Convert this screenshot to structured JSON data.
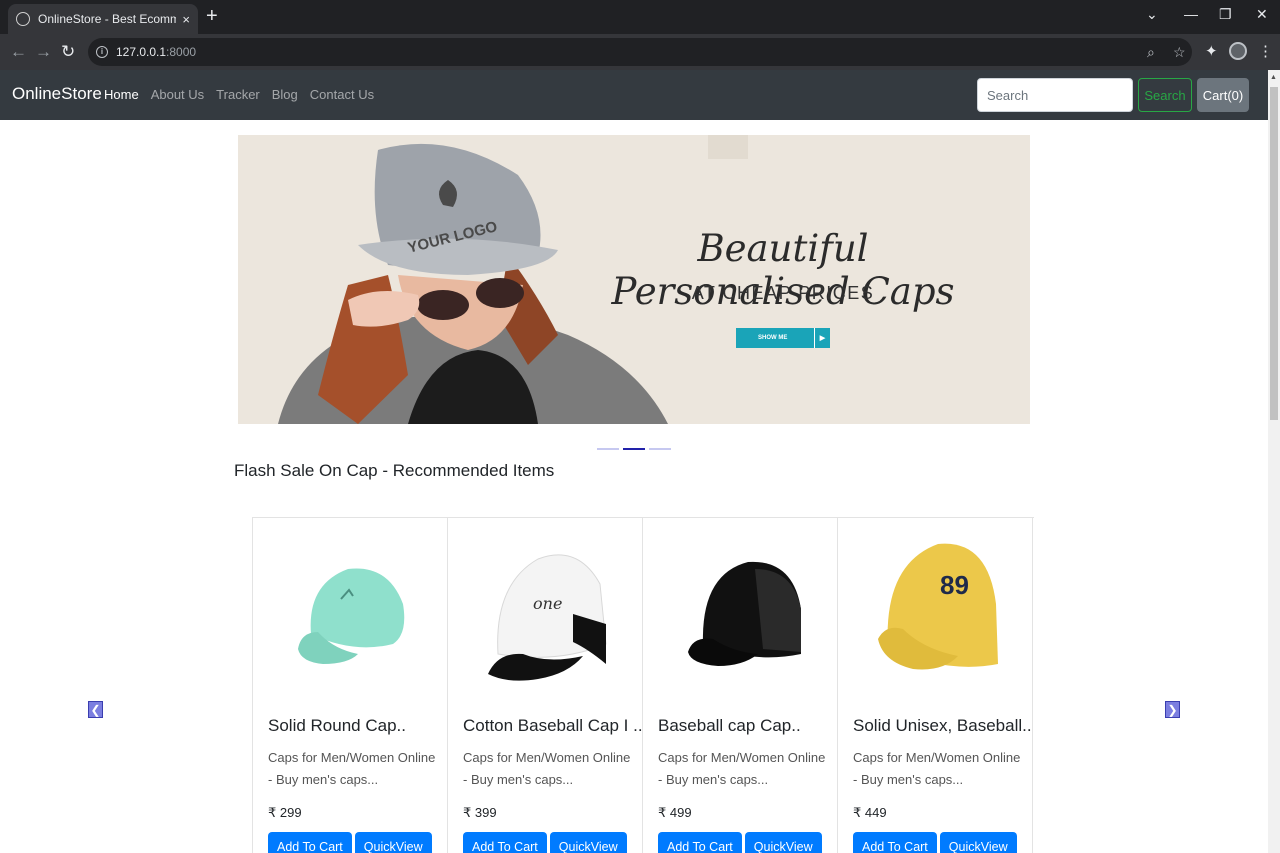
{
  "browser": {
    "tab_title": "OnlineStore - Best Ecommerce W",
    "tab_close": "×",
    "new_tab": "+",
    "url_host": "127.0.0.1",
    "url_port": ":8000"
  },
  "nav": {
    "brand": "OnlineStore",
    "links": [
      "Home",
      "About Us",
      "Tracker",
      "Blog",
      "Contact Us"
    ],
    "search_placeholder": "Search",
    "search_button": "Search",
    "cart_button": "Cart(0)"
  },
  "banner": {
    "headline": "Beautiful Personalised Caps",
    "subheadline": "AT CHEAP PRICES",
    "cta": "SHOW ME",
    "logo_text": "YOUR LOGO"
  },
  "section": {
    "title": "Flash Sale On Cap - Recommended Items"
  },
  "products": [
    {
      "title": "Solid Round Cap..",
      "desc": "Caps for Men/Women Online - Buy men's caps...",
      "price": "₹ 299",
      "color": "#8fe0cc"
    },
    {
      "title": "Cotton Baseball Cap I ..",
      "desc": "Caps for Men/Women Online - Buy men's caps...",
      "price": "₹ 399",
      "color": "#f4f4f4"
    },
    {
      "title": "Baseball cap Cap..",
      "desc": "Caps for Men/Women Online - Buy men's caps...",
      "price": "₹ 499",
      "color": "#111111"
    },
    {
      "title": "Solid Unisex, Baseball..",
      "desc": "Caps for Men/Women Online - Buy men's caps...",
      "price": "₹ 449",
      "color": "#ecc84a"
    }
  ],
  "card_buttons": {
    "add": "Add To Cart",
    "quickview": "QuickView"
  },
  "colors": {
    "navbar": "#343a40",
    "primary": "#007bff",
    "success": "#28a745"
  }
}
